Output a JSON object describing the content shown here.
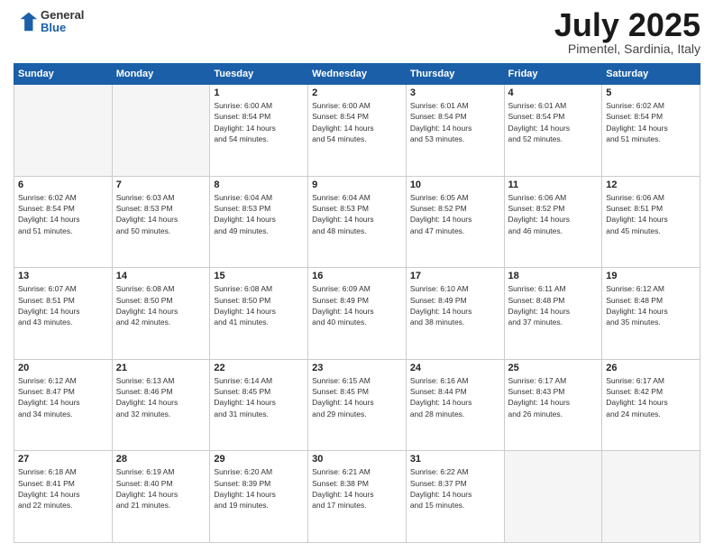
{
  "header": {
    "logo": {
      "general": "General",
      "blue": "Blue"
    },
    "title": "July 2025",
    "subtitle": "Pimentel, Sardinia, Italy"
  },
  "calendar": {
    "days": [
      "Sunday",
      "Monday",
      "Tuesday",
      "Wednesday",
      "Thursday",
      "Friday",
      "Saturday"
    ],
    "weeks": [
      [
        {
          "num": "",
          "info": ""
        },
        {
          "num": "",
          "info": ""
        },
        {
          "num": "1",
          "info": "Sunrise: 6:00 AM\nSunset: 8:54 PM\nDaylight: 14 hours\nand 54 minutes."
        },
        {
          "num": "2",
          "info": "Sunrise: 6:00 AM\nSunset: 8:54 PM\nDaylight: 14 hours\nand 54 minutes."
        },
        {
          "num": "3",
          "info": "Sunrise: 6:01 AM\nSunset: 8:54 PM\nDaylight: 14 hours\nand 53 minutes."
        },
        {
          "num": "4",
          "info": "Sunrise: 6:01 AM\nSunset: 8:54 PM\nDaylight: 14 hours\nand 52 minutes."
        },
        {
          "num": "5",
          "info": "Sunrise: 6:02 AM\nSunset: 8:54 PM\nDaylight: 14 hours\nand 51 minutes."
        }
      ],
      [
        {
          "num": "6",
          "info": "Sunrise: 6:02 AM\nSunset: 8:54 PM\nDaylight: 14 hours\nand 51 minutes."
        },
        {
          "num": "7",
          "info": "Sunrise: 6:03 AM\nSunset: 8:53 PM\nDaylight: 14 hours\nand 50 minutes."
        },
        {
          "num": "8",
          "info": "Sunrise: 6:04 AM\nSunset: 8:53 PM\nDaylight: 14 hours\nand 49 minutes."
        },
        {
          "num": "9",
          "info": "Sunrise: 6:04 AM\nSunset: 8:53 PM\nDaylight: 14 hours\nand 48 minutes."
        },
        {
          "num": "10",
          "info": "Sunrise: 6:05 AM\nSunset: 8:52 PM\nDaylight: 14 hours\nand 47 minutes."
        },
        {
          "num": "11",
          "info": "Sunrise: 6:06 AM\nSunset: 8:52 PM\nDaylight: 14 hours\nand 46 minutes."
        },
        {
          "num": "12",
          "info": "Sunrise: 6:06 AM\nSunset: 8:51 PM\nDaylight: 14 hours\nand 45 minutes."
        }
      ],
      [
        {
          "num": "13",
          "info": "Sunrise: 6:07 AM\nSunset: 8:51 PM\nDaylight: 14 hours\nand 43 minutes."
        },
        {
          "num": "14",
          "info": "Sunrise: 6:08 AM\nSunset: 8:50 PM\nDaylight: 14 hours\nand 42 minutes."
        },
        {
          "num": "15",
          "info": "Sunrise: 6:08 AM\nSunset: 8:50 PM\nDaylight: 14 hours\nand 41 minutes."
        },
        {
          "num": "16",
          "info": "Sunrise: 6:09 AM\nSunset: 8:49 PM\nDaylight: 14 hours\nand 40 minutes."
        },
        {
          "num": "17",
          "info": "Sunrise: 6:10 AM\nSunset: 8:49 PM\nDaylight: 14 hours\nand 38 minutes."
        },
        {
          "num": "18",
          "info": "Sunrise: 6:11 AM\nSunset: 8:48 PM\nDaylight: 14 hours\nand 37 minutes."
        },
        {
          "num": "19",
          "info": "Sunrise: 6:12 AM\nSunset: 8:48 PM\nDaylight: 14 hours\nand 35 minutes."
        }
      ],
      [
        {
          "num": "20",
          "info": "Sunrise: 6:12 AM\nSunset: 8:47 PM\nDaylight: 14 hours\nand 34 minutes."
        },
        {
          "num": "21",
          "info": "Sunrise: 6:13 AM\nSunset: 8:46 PM\nDaylight: 14 hours\nand 32 minutes."
        },
        {
          "num": "22",
          "info": "Sunrise: 6:14 AM\nSunset: 8:45 PM\nDaylight: 14 hours\nand 31 minutes."
        },
        {
          "num": "23",
          "info": "Sunrise: 6:15 AM\nSunset: 8:45 PM\nDaylight: 14 hours\nand 29 minutes."
        },
        {
          "num": "24",
          "info": "Sunrise: 6:16 AM\nSunset: 8:44 PM\nDaylight: 14 hours\nand 28 minutes."
        },
        {
          "num": "25",
          "info": "Sunrise: 6:17 AM\nSunset: 8:43 PM\nDaylight: 14 hours\nand 26 minutes."
        },
        {
          "num": "26",
          "info": "Sunrise: 6:17 AM\nSunset: 8:42 PM\nDaylight: 14 hours\nand 24 minutes."
        }
      ],
      [
        {
          "num": "27",
          "info": "Sunrise: 6:18 AM\nSunset: 8:41 PM\nDaylight: 14 hours\nand 22 minutes."
        },
        {
          "num": "28",
          "info": "Sunrise: 6:19 AM\nSunset: 8:40 PM\nDaylight: 14 hours\nand 21 minutes."
        },
        {
          "num": "29",
          "info": "Sunrise: 6:20 AM\nSunset: 8:39 PM\nDaylight: 14 hours\nand 19 minutes."
        },
        {
          "num": "30",
          "info": "Sunrise: 6:21 AM\nSunset: 8:38 PM\nDaylight: 14 hours\nand 17 minutes."
        },
        {
          "num": "31",
          "info": "Sunrise: 6:22 AM\nSunset: 8:37 PM\nDaylight: 14 hours\nand 15 minutes."
        },
        {
          "num": "",
          "info": ""
        },
        {
          "num": "",
          "info": ""
        }
      ]
    ]
  }
}
